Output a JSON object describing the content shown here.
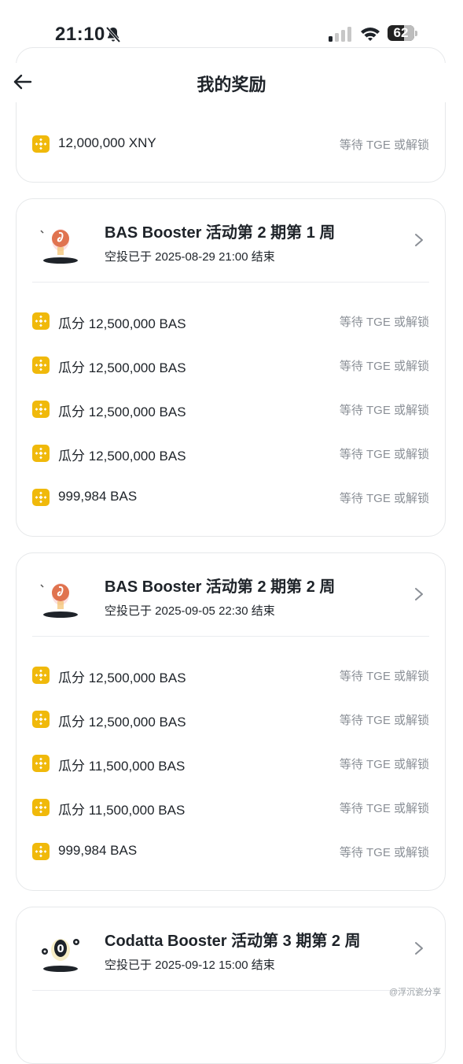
{
  "status_bar": {
    "time": "21:10",
    "battery": "62",
    "battery_level": 0.62
  },
  "header": {
    "title": "我的奖励"
  },
  "card0": {
    "rows": [
      {
        "amount": "12,000,000 XNY",
        "status": "等待 TGE 或解锁"
      }
    ]
  },
  "card1": {
    "title": "BAS Booster 活动第 2 期第 1 周",
    "subtitle": "空投已于 2025-08-29 21:00 结束",
    "rows": [
      {
        "amount": "瓜分 12,500,000 BAS",
        "status": "等待 TGE 或解锁"
      },
      {
        "amount": "瓜分 12,500,000 BAS",
        "status": "等待 TGE 或解锁"
      },
      {
        "amount": "瓜分 12,500,000 BAS",
        "status": "等待 TGE 或解锁"
      },
      {
        "amount": "瓜分 12,500,000 BAS",
        "status": "等待 TGE 或解锁"
      },
      {
        "amount": "999,984 BAS",
        "status": "等待 TGE 或解锁"
      }
    ]
  },
  "card2": {
    "title": "BAS Booster 活动第 2 期第 2 周",
    "subtitle": "空投已于 2025-09-05 22:30 结束",
    "rows": [
      {
        "amount": "瓜分 12,500,000 BAS",
        "status": "等待 TGE 或解锁"
      },
      {
        "amount": "瓜分 12,500,000 BAS",
        "status": "等待 TGE 或解锁"
      },
      {
        "amount": "瓜分 11,500,000 BAS",
        "status": "等待 TGE 或解锁"
      },
      {
        "amount": "瓜分 11,500,000 BAS",
        "status": "等待 TGE 或解锁"
      },
      {
        "amount": "999,984 BAS",
        "status": "等待 TGE 或解锁"
      }
    ]
  },
  "card3": {
    "title": "Codatta Booster 活动第 3 期第 2 周",
    "subtitle": "空投已于 2025-09-12 15:00 结束"
  },
  "watermark": "@浮沉瓷分享",
  "icons": {
    "back": "arrow-left-icon",
    "chevron": "chevron-right-icon",
    "coin": "binance-coin-icon",
    "bell": "bell-slash-icon",
    "signal": "cellular-signal-icon",
    "wifi": "wifi-icon"
  },
  "colors": {
    "accent": "#f0b90b",
    "status_gray": "#8a8f96",
    "text": "#1e2329",
    "border": "#e6e8ea"
  }
}
